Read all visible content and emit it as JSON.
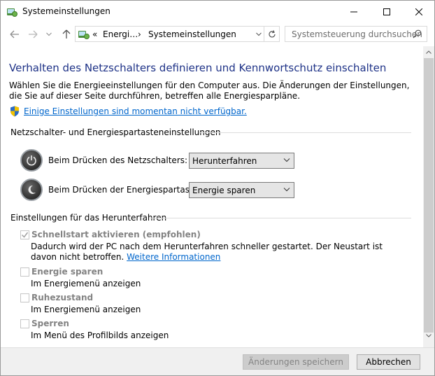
{
  "window": {
    "title": "Systemeinstellungen"
  },
  "nav": {
    "breadcrumb_prefix": "«",
    "breadcrumb_parent": "Energi…",
    "breadcrumb_sep": "›",
    "breadcrumb_current": "Systemeinstellungen",
    "search_placeholder": "Systemsteuerung durchsuchen"
  },
  "content": {
    "heading": "Verhalten des Netzschalters definieren und Kennwortschutz einschalten",
    "description": "Wählen Sie die Energieeinstellungen für den Computer aus. Die Änderungen der Einstellungen, die Sie auf dieser Seite durchführen, betreffen alle Energiesparpläne.",
    "unavailable_link": "Einige Einstellungen sind momentan nicht verfügbar.",
    "power_group_title": "Netzschalter- und Energiespartasteneinstellungen",
    "power_button_label": "Beim Drücken des Netzschalters:",
    "power_button_value": "Herunterfahren",
    "sleep_button_label": "Beim Drücken der Energiespartaste:",
    "sleep_button_value": "Energie sparen",
    "shutdown_group_title": "Einstellungen für das Herunterfahren",
    "options": [
      {
        "label": "Schnellstart aktivieren (empfohlen)",
        "checked": true,
        "desc": "Dadurch wird der PC nach dem Herunterfahren schneller gestartet. Der Neustart ist davon nicht betroffen.",
        "link": "Weitere Informationen"
      },
      {
        "label": "Energie sparen",
        "checked": false,
        "desc": "Im Energiemenü anzeigen"
      },
      {
        "label": "Ruhezustand",
        "checked": false,
        "desc": "Im Energiemenü anzeigen"
      },
      {
        "label": "Sperren",
        "checked": false,
        "desc": "Im Menü des Profilbilds anzeigen"
      }
    ]
  },
  "footer": {
    "save_label": "Änderungen speichern",
    "cancel_label": "Abbrechen"
  },
  "colors": {
    "heading": "#1e3287",
    "link": "#0066cc",
    "disabled_text": "#838383"
  }
}
